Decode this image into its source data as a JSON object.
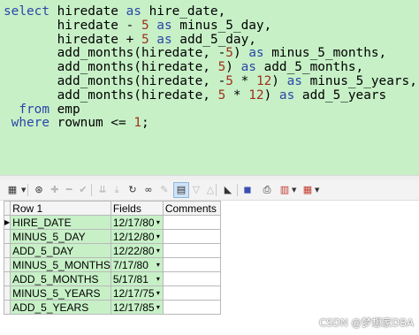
{
  "editor": {
    "lines": [
      [
        {
          "t": "select",
          "c": "kw"
        },
        {
          "t": " hiredate ",
          "c": "op"
        },
        {
          "t": "as",
          "c": "kw"
        },
        {
          "t": " hire_date,",
          "c": "op"
        }
      ],
      [
        {
          "t": "       hiredate - ",
          "c": "op"
        },
        {
          "t": "5",
          "c": "num"
        },
        {
          "t": " ",
          "c": "op"
        },
        {
          "t": "as",
          "c": "kw"
        },
        {
          "t": " minus_5_day,",
          "c": "op"
        }
      ],
      [
        {
          "t": "       hiredate + ",
          "c": "op"
        },
        {
          "t": "5",
          "c": "num"
        },
        {
          "t": " ",
          "c": "op"
        },
        {
          "t": "as",
          "c": "kw"
        },
        {
          "t": " add_5_day,",
          "c": "op"
        }
      ],
      [
        {
          "t": "       add_months(hiredate, -",
          "c": "op"
        },
        {
          "t": "5",
          "c": "num"
        },
        {
          "t": ") ",
          "c": "op"
        },
        {
          "t": "as",
          "c": "kw"
        },
        {
          "t": " minus_5_months,",
          "c": "op"
        }
      ],
      [
        {
          "t": "       add_months(hiredate, ",
          "c": "op"
        },
        {
          "t": "5",
          "c": "num"
        },
        {
          "t": ") ",
          "c": "op"
        },
        {
          "t": "as",
          "c": "kw"
        },
        {
          "t": " add_5_months,",
          "c": "op"
        }
      ],
      [
        {
          "t": "       add_months(hiredate, -",
          "c": "op"
        },
        {
          "t": "5",
          "c": "num"
        },
        {
          "t": " * ",
          "c": "op"
        },
        {
          "t": "12",
          "c": "num"
        },
        {
          "t": ") ",
          "c": "op"
        },
        {
          "t": "as",
          "c": "kw"
        },
        {
          "t": " minus_5_years,",
          "c": "op"
        }
      ],
      [
        {
          "t": "       add_months(hiredate, ",
          "c": "op"
        },
        {
          "t": "5",
          "c": "num"
        },
        {
          "t": " * ",
          "c": "op"
        },
        {
          "t": "12",
          "c": "num"
        },
        {
          "t": ") ",
          "c": "op"
        },
        {
          "t": "as",
          "c": "kw"
        },
        {
          "t": " add_5_years",
          "c": "op"
        }
      ],
      [
        {
          "t": "  ",
          "c": "op"
        },
        {
          "t": "from",
          "c": "kw"
        },
        {
          "t": " emp",
          "c": "op"
        }
      ],
      [
        {
          "t": " ",
          "c": "op"
        },
        {
          "t": "where",
          "c": "kw"
        },
        {
          "t": " rownum <= ",
          "c": "op"
        },
        {
          "t": "1",
          "c": "num"
        },
        {
          "t": ";",
          "c": "op"
        }
      ]
    ]
  },
  "grid": {
    "headers": {
      "row": "Row 1",
      "fields": "Fields",
      "comments": "Comments"
    },
    "rows": [
      {
        "name": "HIRE_DATE",
        "value": "12/17/80",
        "comment": ""
      },
      {
        "name": "MINUS_5_DAY",
        "value": "12/12/80",
        "comment": ""
      },
      {
        "name": "ADD_5_DAY",
        "value": "12/22/80",
        "comment": ""
      },
      {
        "name": "MINUS_5_MONTHS",
        "value": "7/17/80",
        "comment": ""
      },
      {
        "name": "ADD_5_MONTHS",
        "value": "5/17/81",
        "comment": ""
      },
      {
        "name": "MINUS_5_YEARS",
        "value": "12/17/75",
        "comment": ""
      },
      {
        "name": "ADD_5_YEARS",
        "value": "12/17/85",
        "comment": ""
      }
    ],
    "current_row_marker": "▶",
    "dropdown_glyph": "▾"
  },
  "toolbar": {
    "buttons": [
      {
        "icon": "grid-view-icon",
        "glyph": "▦",
        "state": "normal"
      },
      {
        "icon": "lock-icon",
        "glyph": "⊛",
        "state": "normal"
      },
      {
        "icon": "add-record-icon",
        "glyph": "✚",
        "state": "dim"
      },
      {
        "icon": "delete-record-icon",
        "glyph": "━",
        "state": "dim"
      },
      {
        "icon": "post-changes-icon",
        "glyph": "✔",
        "state": "dim"
      },
      {
        "icon": "fetch-next-icon",
        "glyph": "⇊",
        "state": "dim"
      },
      {
        "icon": "fetch-last-icon",
        "glyph": "⤓",
        "state": "dim"
      },
      {
        "icon": "query-by-example-icon",
        "glyph": "↻",
        "state": "normal"
      },
      {
        "icon": "binoculars-icon",
        "glyph": "∞",
        "state": "normal"
      },
      {
        "icon": "clear-icon",
        "glyph": "✎",
        "state": "dim"
      },
      {
        "icon": "single-record-view-icon",
        "glyph": "▤",
        "state": "active"
      },
      {
        "icon": "previous-record-icon",
        "glyph": "▽",
        "state": "dim"
      },
      {
        "icon": "next-record-icon",
        "glyph": "△",
        "state": "dim"
      },
      {
        "icon": "chart-icon",
        "glyph": "◣",
        "state": "normal"
      },
      {
        "icon": "save-icon",
        "glyph": "◼",
        "state": "normal"
      },
      {
        "icon": "print-icon",
        "glyph": "⎙",
        "state": "normal"
      },
      {
        "icon": "export-icon",
        "glyph": "▥",
        "state": "normal"
      },
      {
        "icon": "table-options-icon",
        "glyph": "▦",
        "state": "normal"
      }
    ],
    "colors": {
      "save": "#3a4fb3",
      "export": "#c0392b",
      "table": "#c0392b"
    }
  },
  "watermark": "CSDN @梦想家DBA",
  "colors": {
    "editor_bg": "#c7f0c7",
    "keyword": "#2b46a8",
    "number": "#a0311c",
    "grid_field_bg": "#c7f0c7"
  }
}
